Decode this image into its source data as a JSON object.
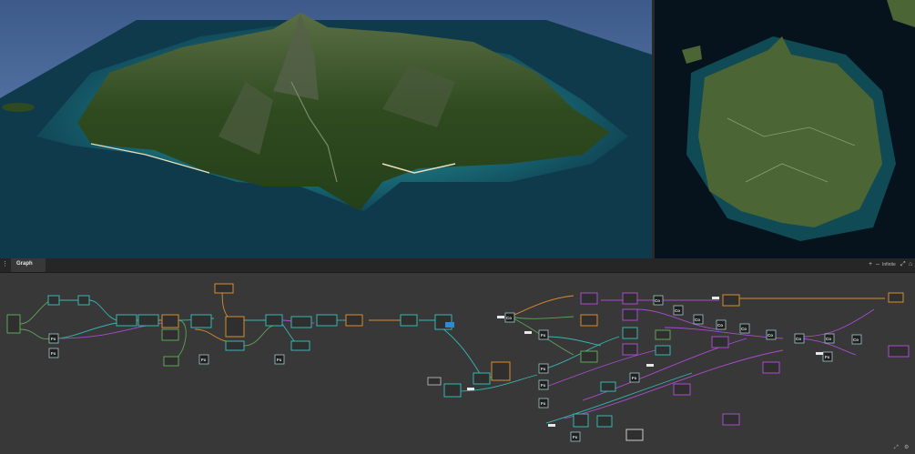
{
  "app": {
    "panel_title": "Graph"
  },
  "graph_toolbar": {
    "add": "+",
    "zoom_out": "–",
    "mode": "Infinite",
    "fit": "⤢",
    "home": "⌂"
  },
  "colors": {
    "wire_teal": "#35b7b0",
    "wire_green": "#5fa35a",
    "wire_orange": "#d88e2a",
    "wire_purple": "#a94ccf",
    "node_bg": "#2f2f2f",
    "panel_bg": "#383838",
    "ocean": "#0b3040",
    "land": "#3f5c2a"
  },
  "icons": [
    "menu-icon",
    "plus-icon",
    "minus-icon",
    "fit-view-icon",
    "home-icon",
    "resize-icon",
    "settings-icon"
  ],
  "nodes_left": [
    {
      "id": "n1"
    },
    {
      "id": "n2"
    },
    {
      "id": "n3"
    },
    {
      "id": "n4"
    },
    {
      "id": "n5"
    },
    {
      "id": "n6"
    },
    {
      "id": "n7"
    },
    {
      "id": "n8"
    },
    {
      "id": "n9"
    },
    {
      "id": "n10"
    },
    {
      "id": "n11"
    },
    {
      "id": "n12"
    },
    {
      "id": "n13"
    },
    {
      "id": "n14"
    },
    {
      "id": "n15"
    },
    {
      "id": "n16"
    },
    {
      "id": "n17"
    },
    {
      "id": "n18"
    },
    {
      "id": "n19"
    },
    {
      "id": "n20"
    },
    {
      "id": "n21"
    },
    {
      "id": "n22"
    }
  ],
  "fx_label": "Fx",
  "co_label": "Co"
}
